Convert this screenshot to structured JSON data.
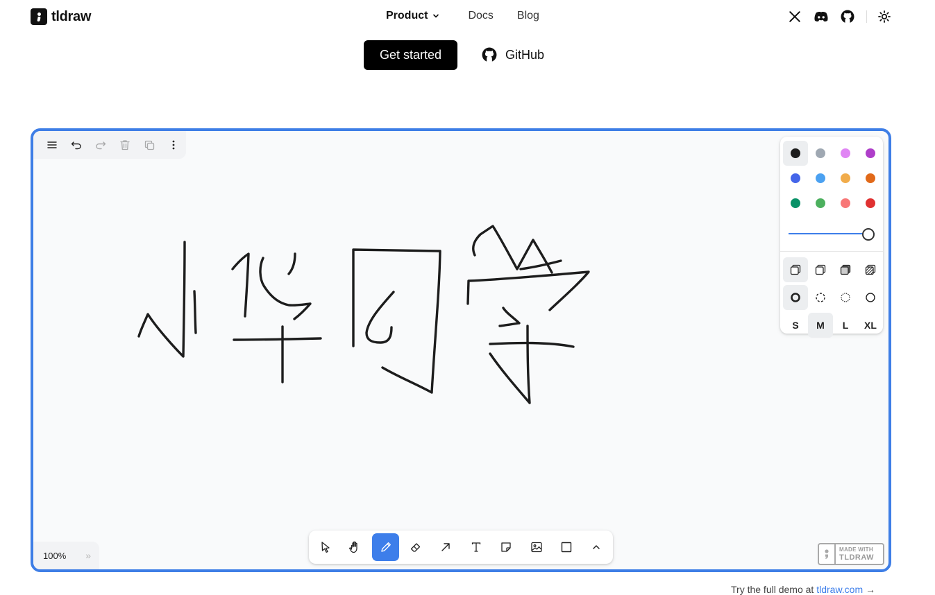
{
  "nav": {
    "logo_text": "tldraw",
    "links": [
      {
        "label": "Product"
      },
      {
        "label": "Docs"
      },
      {
        "label": "Blog"
      }
    ],
    "icons": [
      "x-icon",
      "discord-icon",
      "github-icon",
      "theme-toggle-icon"
    ]
  },
  "hero": {
    "cta_label": "Get started",
    "github_label": "GitHub"
  },
  "editor": {
    "menu_icons": [
      "menu-icon",
      "undo-icon",
      "redo-icon",
      "trash-icon",
      "duplicate-icon",
      "more-icon"
    ],
    "drawing_text": "小华同学",
    "style_panel": {
      "colors": [
        "#1d1d1d",
        "#9fa8b2",
        "#e085f4",
        "#ae3ec9",
        "#4465e9",
        "#4ba1f1",
        "#f1ac4b",
        "#e16919",
        "#099268",
        "#4cb05e",
        "#f87777",
        "#e03131"
      ],
      "active_color": "#1d1d1d",
      "opacity": 1,
      "fill_options": [
        "fill-none-icon",
        "fill-semi-icon",
        "fill-solid-icon",
        "fill-pattern-icon"
      ],
      "dash_options": [
        "dash-draw-icon",
        "dash-dashed-icon",
        "dash-dotted-icon",
        "dash-solid-icon"
      ],
      "sizes": [
        "S",
        "M",
        "L",
        "XL"
      ],
      "active_size": "M"
    },
    "zoom_label": "100%",
    "zoom_chevron": "»",
    "tools": [
      "select-tool",
      "hand-tool",
      "draw-tool",
      "eraser-tool",
      "arrow-tool",
      "text-tool",
      "note-tool",
      "image-tool",
      "rectangle-tool",
      "more-tools"
    ],
    "active_tool": "draw-tool",
    "badge": {
      "line1": "MADE WITH",
      "line2": "TLDRAW"
    }
  },
  "footer": {
    "text_prefix": "Try the full demo at",
    "link": "tldraw.com",
    "suffix": "→"
  }
}
